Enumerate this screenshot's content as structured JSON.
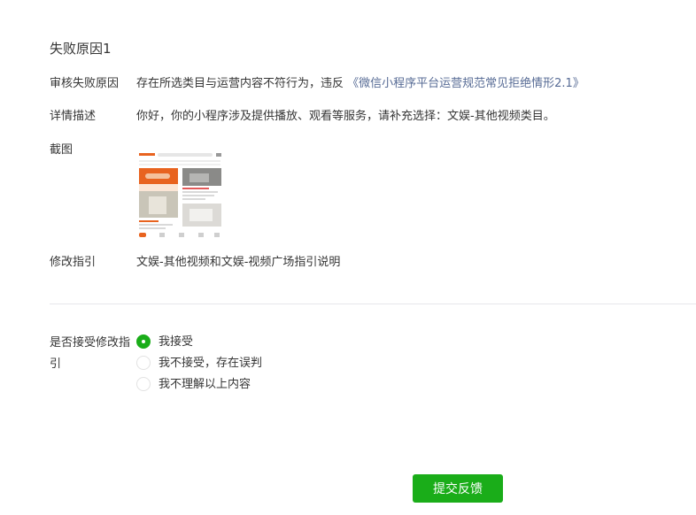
{
  "reason": {
    "title": "失败原因1",
    "audit_label": "审核失败原因",
    "audit_text": "存在所选类目与运营内容不符行为，违反",
    "audit_link": "《微信小程序平台运营规范常见拒绝情形2.1》",
    "detail_label": "详情描述",
    "detail_text": "你好，你的小程序涉及提供播放、观看等服务，请补充选择：文娱-其他视频类目。",
    "screenshot_label": "截图",
    "guide_label": "修改指引",
    "guide_link": "文娱-其他视频和文娱-视频广场指引说明"
  },
  "accept": {
    "label": "是否接受修改指引",
    "options": [
      {
        "label": "我接受",
        "checked": true
      },
      {
        "label": "我不接受，存在误判",
        "checked": false
      },
      {
        "label": "我不理解以上内容",
        "checked": false
      }
    ]
  },
  "submit_label": "提交反馈",
  "colors": {
    "primary": "#1aad19",
    "link": "#576b95",
    "text": "#353535",
    "divider": "#e7e7eb"
  }
}
